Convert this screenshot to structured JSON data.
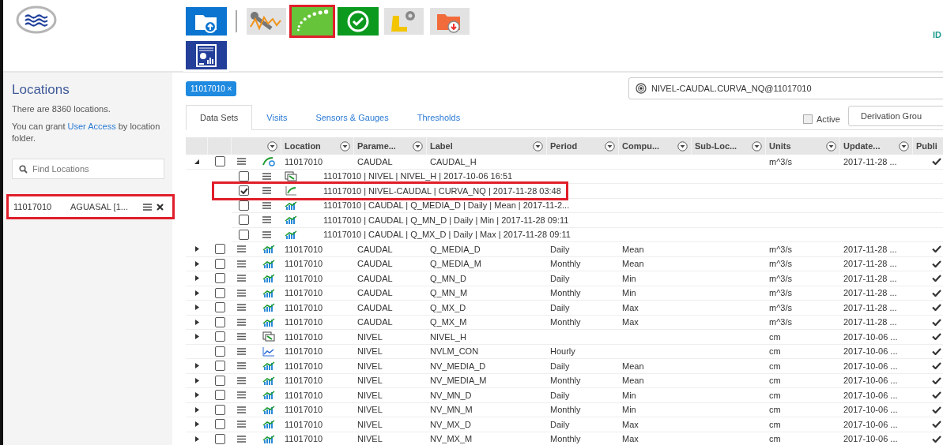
{
  "logo": {
    "text": "ID"
  },
  "toolbar": {
    "rows": [
      [
        {
          "kind": "upload",
          "highlighted": false
        },
        {
          "kind": "separator"
        },
        {
          "kind": "tools",
          "highlighted": false
        },
        {
          "kind": "curve",
          "highlighted": true
        },
        {
          "kind": "approve",
          "highlighted": false
        },
        {
          "kind": "boot",
          "highlighted": false
        },
        {
          "kind": "download",
          "highlighted": false
        }
      ],
      [
        {
          "kind": "report",
          "highlighted": false
        }
      ]
    ]
  },
  "sidebar": {
    "title": "Locations",
    "count_text": "There are 8360 locations.",
    "grant_text": {
      "before": "You can grant",
      "link": "User Access",
      "after": "by location folder."
    },
    "search": {
      "placeholder": "Find Locations"
    },
    "items": [
      {
        "identifier": "11017010",
        "name": "AGUASAL [1...",
        "highlighted": true
      }
    ]
  },
  "filter_chips": [
    {
      "label": "11017010",
      "remove": "×"
    }
  ],
  "identifier_field": {
    "value": "NIVEL-CAUDAL.CURVA_NQ@11017010"
  },
  "tabs": [
    {
      "label": "Data Sets",
      "selected": true
    },
    {
      "label": "Visits",
      "selected": false
    },
    {
      "label": "Sensors & Gauges",
      "selected": false
    },
    {
      "label": "Thresholds",
      "selected": false
    }
  ],
  "active_filter": {
    "label": "Active",
    "checked": false
  },
  "derivation_button": {
    "label": "Derivation Grou"
  },
  "table": {
    "type_column": {
      "filter": true
    },
    "columns": [
      {
        "label": "Location",
        "filter": true
      },
      {
        "label": "Parame...",
        "filter": true
      },
      {
        "label": "Label",
        "filter": true
      },
      {
        "label": "Period",
        "filter": true
      },
      {
        "label": "Compu...",
        "filter": true
      },
      {
        "label": "Sub-Loc...",
        "filter": true
      },
      {
        "label": "Units",
        "filter": true
      },
      {
        "label": "Update...",
        "filter": true
      },
      {
        "label": "Publi"
      }
    ],
    "rows": [
      {
        "kind": "curve-sync",
        "expandable": true,
        "expanded": true,
        "checked": false,
        "location": "11017010",
        "parameter": "CAUDAL",
        "label": "CAUDAL_H",
        "units": "m^3/s",
        "updated": "2017-11-28 ...",
        "published": true,
        "children": [
          {
            "checked": false,
            "kind": "derived",
            "text": "11017010 | NIVEL | NIVEL_H | 2017-10-06 16:51",
            "highlighted": false
          },
          {
            "checked": true,
            "kind": "rating",
            "text": "11017010 | NIVEL-CAUDAL | CURVA_NQ | 2017-11-28 03:48",
            "highlighted": true
          },
          {
            "checked": false,
            "kind": "stats",
            "text": "11017010 | CAUDAL | Q_MEDIA_D | Daily | Mean | 2017-11-2...",
            "highlighted": false
          },
          {
            "checked": false,
            "kind": "stats",
            "text": "11017010 | CAUDAL | Q_MN_D | Daily | Min | 2017-11-28 09:11",
            "highlighted": false
          },
          {
            "checked": false,
            "kind": "stats",
            "text": "11017010 | CAUDAL | Q_MX_D | Daily | Max | 2017-11-28 09:11",
            "highlighted": false
          }
        ]
      },
      {
        "kind": "stats",
        "expandable": true,
        "expanded": false,
        "checked": false,
        "location": "11017010",
        "parameter": "CAUDAL",
        "label": "Q_MEDIA_D",
        "period": "Daily",
        "computation": "Mean",
        "units": "m^3/s",
        "updated": "2017-11-28 ...",
        "published": true
      },
      {
        "kind": "stats",
        "expandable": true,
        "expanded": false,
        "checked": false,
        "location": "11017010",
        "parameter": "CAUDAL",
        "label": "Q_MEDIA_M",
        "period": "Monthly",
        "computation": "Mean",
        "units": "m^3/s",
        "updated": "2017-11-28 ...",
        "published": true
      },
      {
        "kind": "stats",
        "expandable": true,
        "expanded": false,
        "checked": false,
        "location": "11017010",
        "parameter": "CAUDAL",
        "label": "Q_MN_D",
        "period": "Daily",
        "computation": "Min",
        "units": "m^3/s",
        "updated": "2017-11-28 ...",
        "published": true
      },
      {
        "kind": "stats",
        "expandable": true,
        "expanded": false,
        "checked": false,
        "location": "11017010",
        "parameter": "CAUDAL",
        "label": "Q_MN_M",
        "period": "Monthly",
        "computation": "Min",
        "units": "m^3/s",
        "updated": "2017-11-28 ...",
        "published": true
      },
      {
        "kind": "stats",
        "expandable": true,
        "expanded": false,
        "checked": false,
        "location": "11017010",
        "parameter": "CAUDAL",
        "label": "Q_MX_D",
        "period": "Daily",
        "computation": "Max",
        "units": "m^3/s",
        "updated": "2017-11-28 ...",
        "published": true
      },
      {
        "kind": "stats",
        "expandable": true,
        "expanded": false,
        "checked": false,
        "location": "11017010",
        "parameter": "CAUDAL",
        "label": "Q_MX_M",
        "period": "Monthly",
        "computation": "Max",
        "units": "m^3/s",
        "updated": "2017-11-28 ...",
        "published": true
      },
      {
        "kind": "derived",
        "expandable": true,
        "expanded": false,
        "checked": false,
        "location": "11017010",
        "parameter": "NIVEL",
        "label": "NIVEL_H",
        "units": "cm",
        "updated": "2017-10-06 ...",
        "published": true
      },
      {
        "kind": "trend",
        "expandable": false,
        "expanded": false,
        "checked": false,
        "location": "11017010",
        "parameter": "NIVEL",
        "label": "NVLM_CON",
        "period": "Hourly",
        "units": "cm",
        "updated": "2017-10-06 ...",
        "published": true
      },
      {
        "kind": "stats",
        "expandable": true,
        "expanded": false,
        "checked": false,
        "location": "11017010",
        "parameter": "NIVEL",
        "label": "NV_MEDIA_D",
        "period": "Daily",
        "computation": "Mean",
        "units": "cm",
        "updated": "2017-10-06 ...",
        "published": true
      },
      {
        "kind": "stats",
        "expandable": true,
        "expanded": false,
        "checked": false,
        "location": "11017010",
        "parameter": "NIVEL",
        "label": "NV_MEDIA_M",
        "period": "Monthly",
        "computation": "Mean",
        "units": "cm",
        "updated": "2017-10-06 ...",
        "published": true
      },
      {
        "kind": "stats",
        "expandable": true,
        "expanded": false,
        "checked": false,
        "location": "11017010",
        "parameter": "NIVEL",
        "label": "NV_MN_D",
        "period": "Daily",
        "computation": "Min",
        "units": "cm",
        "updated": "2017-10-06 ...",
        "published": true
      },
      {
        "kind": "stats",
        "expandable": true,
        "expanded": false,
        "checked": false,
        "location": "11017010",
        "parameter": "NIVEL",
        "label": "NV_MN_M",
        "period": "Monthly",
        "computation": "Min",
        "units": "cm",
        "updated": "2017-10-06 ...",
        "published": true
      },
      {
        "kind": "stats",
        "expandable": true,
        "expanded": false,
        "checked": false,
        "location": "11017010",
        "parameter": "NIVEL",
        "label": "NV_MX_D",
        "period": "Daily",
        "computation": "Max",
        "units": "cm",
        "updated": "2017-10-06 ...",
        "published": true
      },
      {
        "kind": "stats",
        "expandable": true,
        "expanded": false,
        "checked": false,
        "location": "11017010",
        "parameter": "NIVEL",
        "label": "NV_MX_M",
        "period": "Monthly",
        "computation": "Max",
        "units": "cm",
        "updated": "2017-10-06 ...",
        "published": true
      }
    ]
  }
}
